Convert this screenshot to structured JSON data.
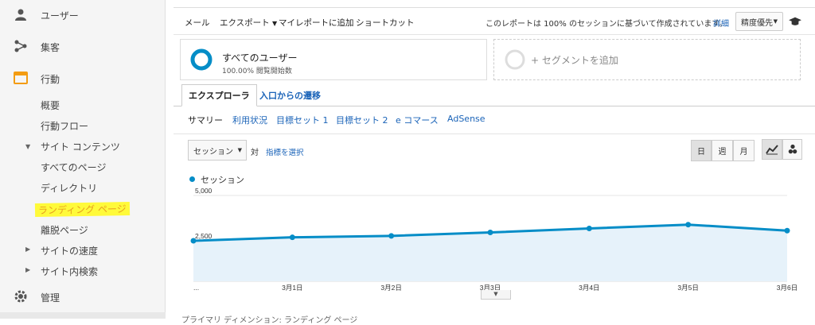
{
  "sidebar": {
    "items": [
      {
        "label": "ユーザー",
        "icon": "person-icon"
      },
      {
        "label": "集客",
        "icon": "acquisition-icon"
      },
      {
        "label": "行動",
        "icon": "behavior-icon"
      }
    ],
    "behavior_subitems": [
      "概要",
      "行動フロー"
    ],
    "site_content": {
      "label": "サイト コンテンツ",
      "children": [
        "すべてのページ",
        "ディレクトリ",
        "ランディング ページ",
        "離脱ページ"
      ]
    },
    "collapsed": [
      "サイトの速度",
      "サイト内検索"
    ],
    "admin": {
      "label": "管理",
      "icon": "gear-icon"
    }
  },
  "toolbar": {
    "items": [
      "メール",
      "エクスポート",
      "マイレポートに追加",
      "ショートカット"
    ],
    "notice": "このレポートは 100% のセッションに基づいて作成されています。",
    "details_link": "詳細",
    "precision_select": "精度優先"
  },
  "segments": {
    "primary": {
      "title": "すべてのユーザー",
      "subtitle": "100.00% 閲覧開始数"
    },
    "add": "+ セグメントを追加"
  },
  "tabs": [
    "エクスプローラ",
    "入口からの遷移"
  ],
  "subtabs": [
    "サマリー",
    "利用状況",
    "目標セット 1",
    "目標セット 2",
    "e コマース",
    "AdSense"
  ],
  "controls": {
    "metric_select": "セッション",
    "vs": "対",
    "choose_metric": "指標を選択",
    "granularity": [
      "日",
      "週",
      "月"
    ]
  },
  "legend": "セッション",
  "colors": {
    "series": "#058dc7",
    "fill": "#e6f2fa",
    "highlight": "#fffa3a",
    "link": "#1a63b8"
  },
  "chart_data": {
    "type": "area",
    "x": [
      "...",
      "3月1日",
      "3月2日",
      "3月3日",
      "3月4日",
      "3月5日",
      "3月6日"
    ],
    "series": [
      {
        "name": "セッション",
        "values": [
          2500,
          2690,
          2770,
          2960,
          3180,
          3390,
          3060
        ]
      }
    ],
    "ylim": [
      0,
      5000
    ],
    "yticks": [
      "5,000",
      "2,500"
    ],
    "grid": true
  },
  "bottom_partial": "プライマリ ディメンション: ランディング ページ"
}
